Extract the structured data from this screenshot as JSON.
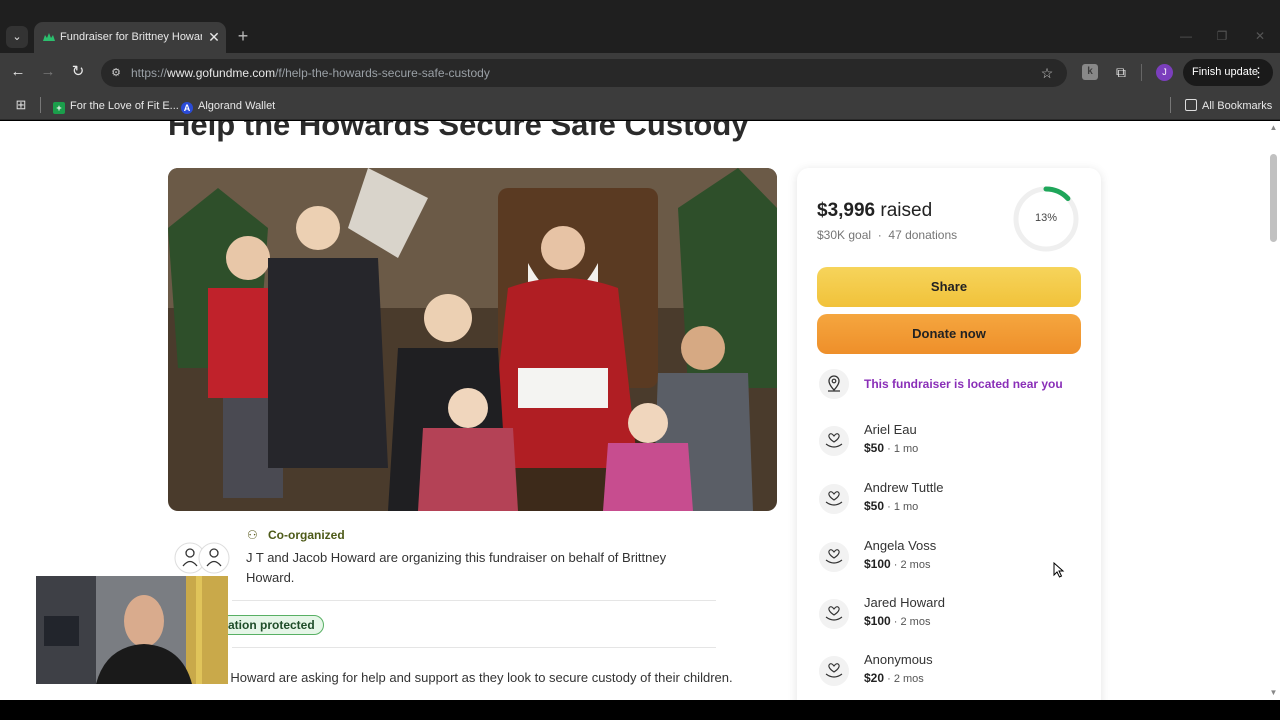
{
  "browser": {
    "tab_title": "Fundraiser for Brittney Howard",
    "url_scheme": "https://",
    "url_host": "www.gofundme.com",
    "url_path": "/f/help-the-howards-secure-safe-custody",
    "finish_update_label": "Finish update",
    "profile_initial": "J",
    "bookmarks": [
      {
        "label": "For the Love of Fit E...",
        "icon": "green-cross-icon"
      },
      {
        "label": "Algorand Wallet",
        "icon": "algorand-icon"
      }
    ],
    "all_bookmarks_label": "All Bookmarks"
  },
  "page": {
    "title": "Help the Howards Secure Safe Custody",
    "co_organized_label": "Co-organized",
    "organizer_text": "J T and Jacob Howard are organizing this fundraiser on behalf of Brittney Howard.",
    "protected_label": "ation protected",
    "story_text": "and Jake Howard are asking for help and support as they look to secure custody of their children."
  },
  "card": {
    "raised_amount": "$3,996",
    "raised_word": "raised",
    "goal": "$30K goal",
    "donations": "47 donations",
    "progress_percent": 13,
    "progress_label": "13%",
    "share_label": "Share",
    "donate_label": "Donate now",
    "near_label": "This fundraiser is located near you",
    "donors": [
      {
        "name": "Ariel Eau",
        "amount": "$50",
        "time": "1 mo"
      },
      {
        "name": "Andrew Tuttle",
        "amount": "$50",
        "time": "1 mo"
      },
      {
        "name": "Angela Voss",
        "amount": "$100",
        "time": "2 mos"
      },
      {
        "name": "Jared Howard",
        "amount": "$100",
        "time": "2 mos"
      },
      {
        "name": "Anonymous",
        "amount": "$20",
        "time": "2 mos"
      }
    ]
  },
  "colors": {
    "accent_green": "#1fa65a",
    "share_yellow": "#f1c23a",
    "donate_orange": "#ee8f2a",
    "near_purple": "#8a2fb8"
  }
}
